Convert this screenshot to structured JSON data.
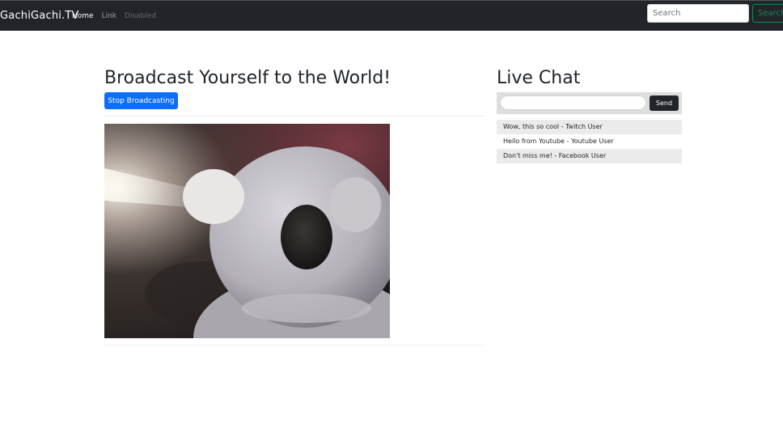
{
  "navbar": {
    "brand": "GachiGachi.TV",
    "links": [
      {
        "label": "Home",
        "state": "active"
      },
      {
        "label": "Link",
        "state": "normal"
      },
      {
        "label": "Disabled",
        "state": "disabled"
      }
    ],
    "search_placeholder": "Search",
    "search_button": "Search"
  },
  "main": {
    "title": "Broadcast Yourself to the World!",
    "stop_button": "Stop Broadcasting"
  },
  "chat": {
    "title": "Live Chat",
    "input_value": "",
    "send_button": "Send",
    "messages": [
      "Wow, this so cool - Twitch User",
      "Hello from Youtube - Youtube User",
      "Don't miss me! - Facebook User"
    ]
  },
  "colors": {
    "navbar_bg": "#212529",
    "primary": "#0d6efd",
    "success": "#198754",
    "dark_button": "#212529"
  }
}
